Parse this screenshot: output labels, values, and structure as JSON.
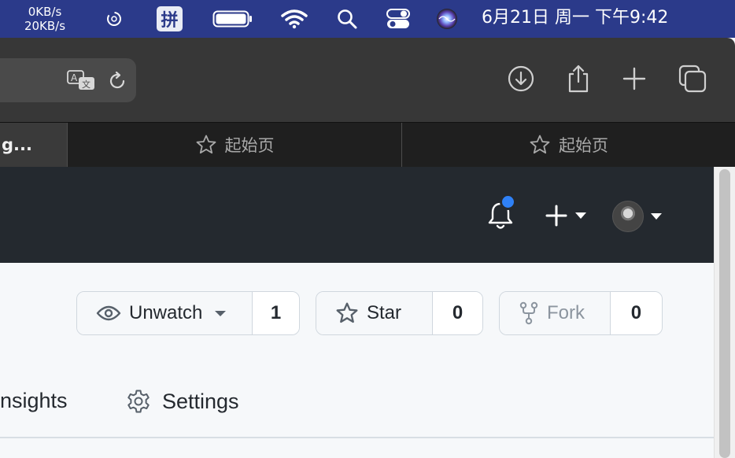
{
  "menubar": {
    "net_up": "0KB/s",
    "net_down": "20KB/s",
    "input_method": "拼",
    "clock": "6月21日 周一 下午9:42"
  },
  "tabs": [
    {
      "label": "g...",
      "active": true
    },
    {
      "label": "起始页",
      "active": false,
      "icon": "star-icon"
    },
    {
      "label": "起始页",
      "active": false,
      "icon": "star-icon"
    }
  ],
  "repo_actions": {
    "watch": {
      "label": "Unwatch",
      "count": "1",
      "icon": "eye-icon"
    },
    "star": {
      "label": "Star",
      "count": "0",
      "icon": "star-icon"
    },
    "fork": {
      "label": "Fork",
      "count": "0",
      "icon": "fork-icon",
      "disabled": true
    }
  },
  "repo_nav": {
    "insights": "nsights",
    "settings": "Settings"
  },
  "colors": {
    "menubar_bg": "#2b3a8a",
    "header_bg": "#24292f",
    "notification_dot": "#2f81f7"
  }
}
